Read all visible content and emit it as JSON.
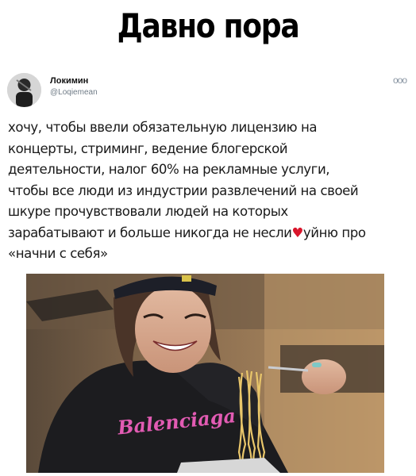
{
  "meme_title": "Давно пора",
  "tweet": {
    "author_name": "Локимин",
    "author_handle": "@Loqiemean",
    "more_icon": "ooo",
    "text_lines": [
      "хочу, чтобы ввели обязательную лицензию на",
      "концерты, стриминг, ведение блогерской",
      "деятельности, налог 60% на рекламные услуги,",
      "чтобы все люди из индустрии развлечений на своей",
      "шкуре прочувствовали людей на которых",
      "зарабатывают и больше никогда не несли",
      "уйню про",
      "«начни с себя»"
    ]
  },
  "photo": {
    "hoodie_text": "Balenciaga",
    "description_icon": "photo-woman-eating-noodles"
  }
}
